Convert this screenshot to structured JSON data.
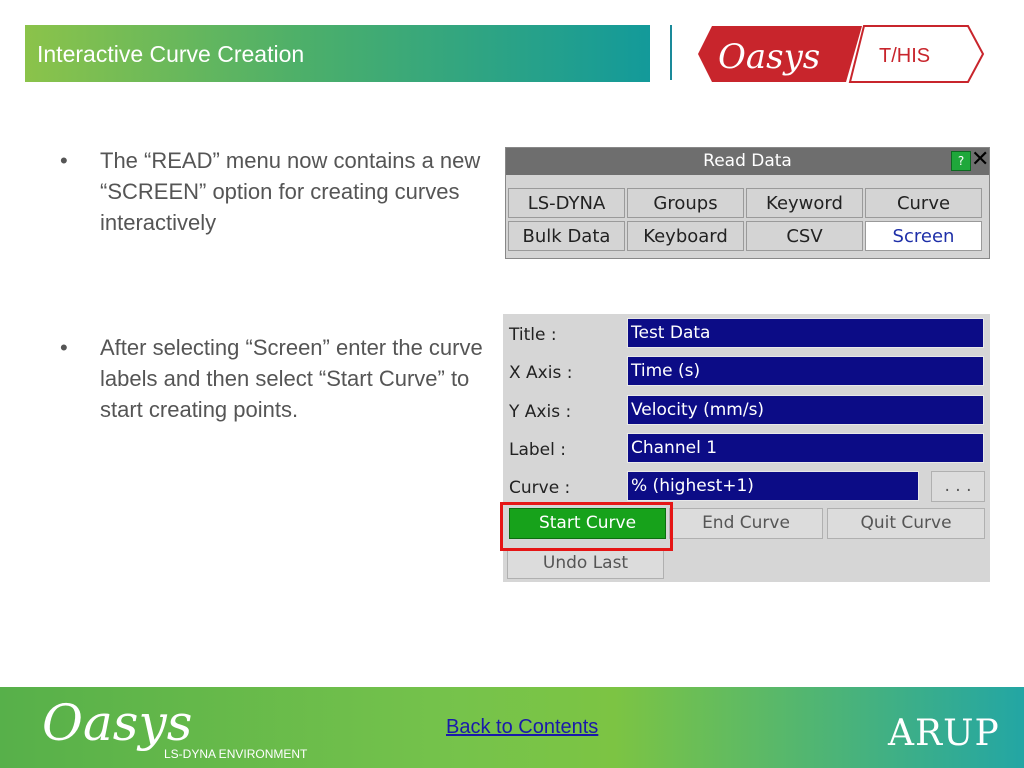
{
  "header": {
    "title": "Interactive Curve Creation"
  },
  "logo": {
    "brand": "Oasys",
    "product": "T/HIS"
  },
  "bullets": [
    "The “READ” menu now contains a new “SCREEN” option for creating curves interactively",
    "After selecting “Screen” enter the curve labels and then select “Start Curve” to start creating points."
  ],
  "read_data": {
    "title": "Read Data",
    "help": "?",
    "close": "✕",
    "buttons": [
      "LS-DYNA",
      "Groups",
      "Keyword",
      "Curve",
      "Bulk Data",
      "Keyboard",
      "CSV",
      "Screen"
    ],
    "selected": "Screen"
  },
  "screen_form": {
    "labels": [
      "Title :",
      "X Axis :",
      "Y Axis :",
      "Label :",
      "Curve :"
    ],
    "values": [
      "Test Data",
      "Time (s)",
      "Velocity (mm/s)",
      "Channel 1",
      "% (highest+1)"
    ],
    "browse": ". . .",
    "start": "Start Curve",
    "end": "End Curve",
    "quit": "Quit Curve",
    "undo": "Undo Last"
  },
  "footer": {
    "brand": "Oasys",
    "subtitle": "LS-DYNA ENVIRONMENT",
    "link": "Back to Contents",
    "company": "ARUP"
  },
  "colors": {
    "field_bg": "#0c0c86",
    "start_green": "#17a21b",
    "highlight_red": "#e51616",
    "selected_text": "#1e2fa8"
  }
}
